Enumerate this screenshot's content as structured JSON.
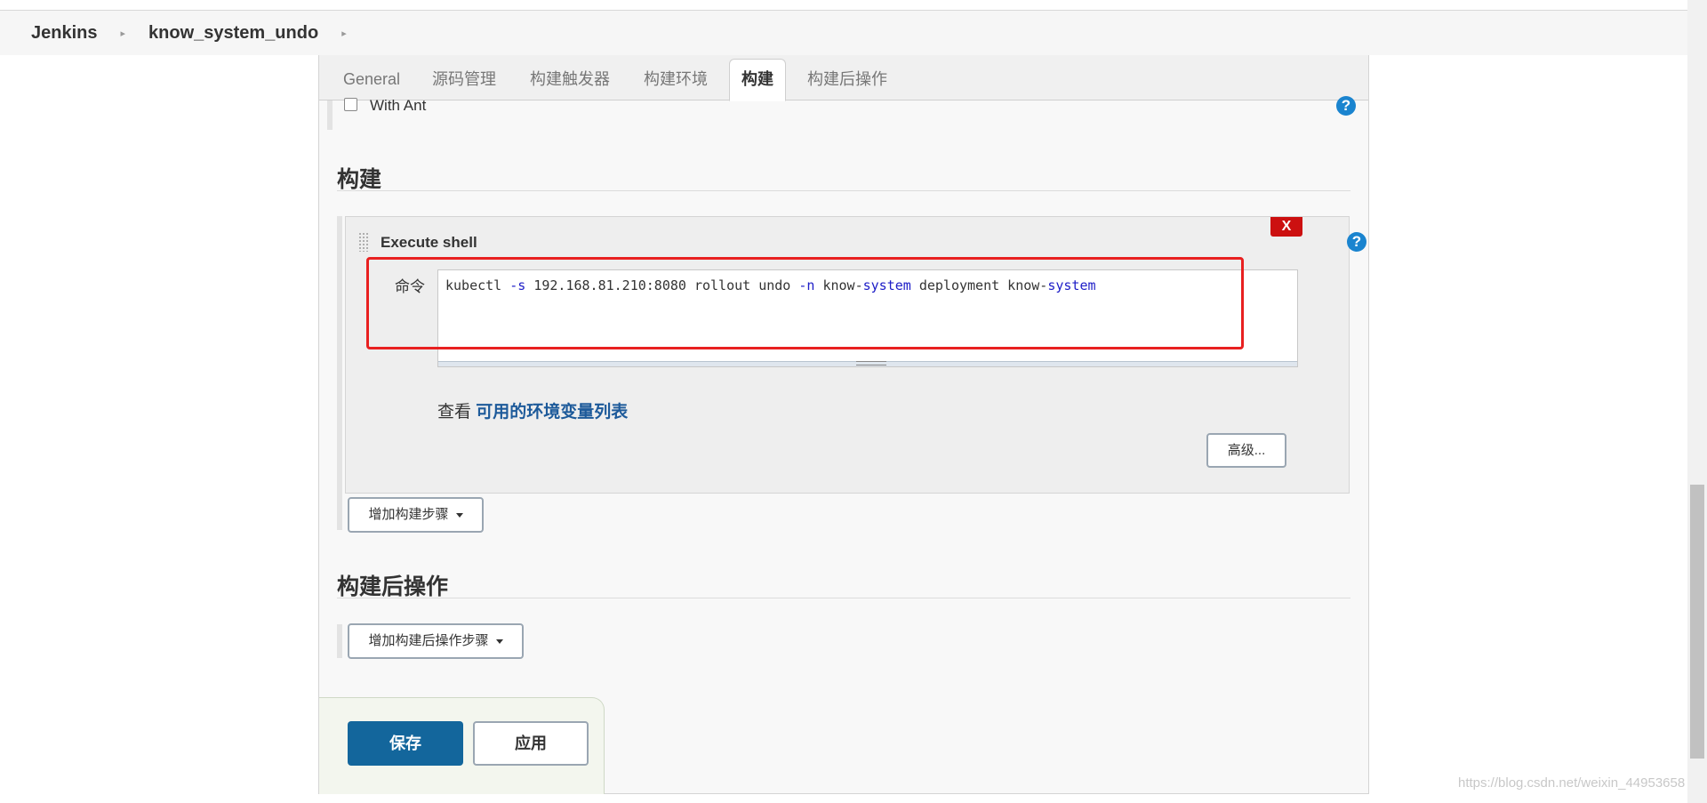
{
  "breadcrumb": {
    "root": "Jenkins",
    "job": "know_system_undo",
    "separator": "▸"
  },
  "tabs": [
    {
      "label": "General"
    },
    {
      "label": "源码管理"
    },
    {
      "label": "构建触发器"
    },
    {
      "label": "构建环境"
    },
    {
      "label": "构建",
      "active": true
    },
    {
      "label": "构建后操作"
    }
  ],
  "build_env": {
    "with_ant_label": "With Ant",
    "with_ant_checked": false
  },
  "build": {
    "section_title": "构建",
    "step": {
      "title": "Execute shell",
      "delete_label": "X",
      "command_label": "命令",
      "command_parts": [
        {
          "text": "kubectl ",
          "kw": false
        },
        {
          "text": "-s",
          "kw": true
        },
        {
          "text": " 192.168.81.210:8080 rollout undo ",
          "kw": false
        },
        {
          "text": "-n",
          "kw": true
        },
        {
          "text": " know-",
          "kw": false
        },
        {
          "text": "system",
          "kw": true
        },
        {
          "text": " deployment know-",
          "kw": false
        },
        {
          "text": "system",
          "kw": true
        }
      ],
      "env_prefix": "查看",
      "env_link": "可用的环境变量列表",
      "advanced_label": "高级..."
    },
    "add_step_label": "增加构建步骤"
  },
  "post_build": {
    "section_title": "构建后操作",
    "add_step_label": "增加构建后操作步骤"
  },
  "footer": {
    "save_label": "保存",
    "apply_label": "应用"
  },
  "help_icon_text": "?",
  "watermark": "https://blog.csdn.net/weixin_44953658",
  "colors": {
    "accent": "#13669c",
    "link": "#1d5a9a",
    "delete": "#cc1010",
    "highlight": "#e82020",
    "help": "#1a84cf"
  }
}
